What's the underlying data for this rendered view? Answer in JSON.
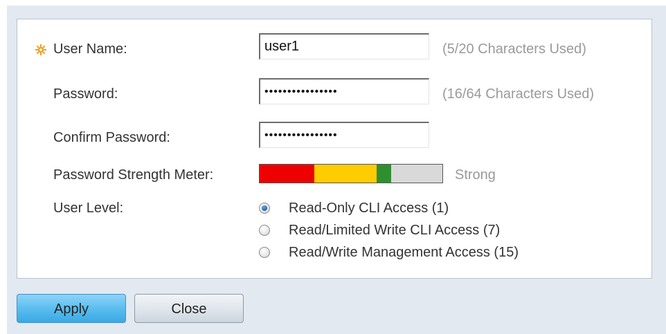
{
  "form": {
    "user_name": {
      "label": "User Name:",
      "value": "user1",
      "hint": "(5/20 Characters Used)",
      "required": true
    },
    "password": {
      "label": "Password:",
      "value": "••••••••••••••••",
      "hint": "(16/64 Characters Used)"
    },
    "confirm_password": {
      "label": "Confirm Password:",
      "value": "••••••••••••••••"
    },
    "strength": {
      "label": "Password Strength Meter:",
      "text": "Strong",
      "level_fraction": 0.72,
      "colors": [
        "#ee0000",
        "#ffcc00",
        "#2f8f2f",
        "#d9d9d9"
      ]
    },
    "user_level": {
      "label": "User Level:",
      "options": [
        {
          "label": "Read-Only CLI Access (1)",
          "checked": true
        },
        {
          "label": "Read/Limited Write CLI Access (7)",
          "checked": false
        },
        {
          "label": "Read/Write Management Access (15)",
          "checked": false
        }
      ]
    }
  },
  "buttons": {
    "apply": "Apply",
    "close": "Close"
  },
  "icons": {
    "required": "required-field-star-icon"
  },
  "theme": {
    "required_icon_color": "#f0a020",
    "hint_color": "#9a9a9a"
  }
}
